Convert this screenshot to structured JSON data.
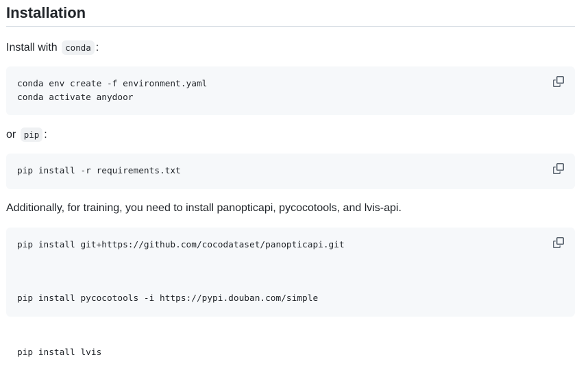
{
  "heading": "Installation",
  "intro": {
    "text_before": "Install with",
    "code": "conda",
    "text_after": ":"
  },
  "block1": {
    "code": "conda env create -f environment.yaml\nconda activate anydoor",
    "copy_icon": "copy-icon"
  },
  "or_line": {
    "text_before": "or",
    "code": "pip",
    "text_after": ":"
  },
  "block2": {
    "code": "pip install -r requirements.txt",
    "copy_icon": "copy-icon"
  },
  "additionally": "Additionally, for training, you need to install panopticapi, pycocotools, and lvis-api.",
  "block3": {
    "code": "pip install git+https://github.com/cocodataset/panopticapi.git\n\npip install pycocotools -i https://pypi.douban.com/simple\n\npip install lvis",
    "copy_icon": "copy-icon"
  },
  "colors": {
    "text": "#1f2328",
    "code_bg": "#f6f8fa",
    "inline_code_bg": "#eff1f3",
    "divider": "#d8dee4",
    "icon": "#59636e"
  }
}
